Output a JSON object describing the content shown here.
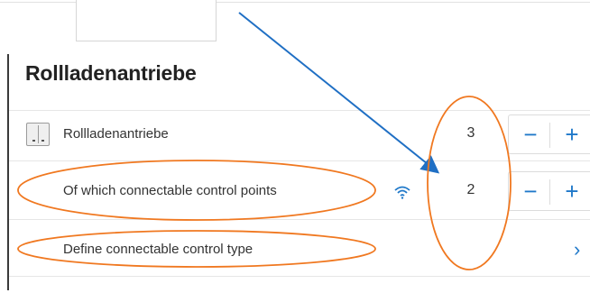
{
  "section": {
    "title": "Rollladenantriebe"
  },
  "rows": [
    {
      "label": "Rollladenantriebe",
      "count": "3",
      "minus": "−",
      "plus": "+"
    },
    {
      "label": "Of which connectable control points",
      "count": "2",
      "minus": "−",
      "plus": "+"
    },
    {
      "label": "Define connectable control type",
      "chevron": "›"
    }
  ],
  "icons": {
    "device": "roller-shutter-icon",
    "wireless": "wifi-icon",
    "chevron": "chevron-right-icon"
  },
  "colors": {
    "accent": "#1f78c9",
    "annotation_arrow": "#1f6fc4",
    "annotation_ellipse": "#f07820"
  }
}
